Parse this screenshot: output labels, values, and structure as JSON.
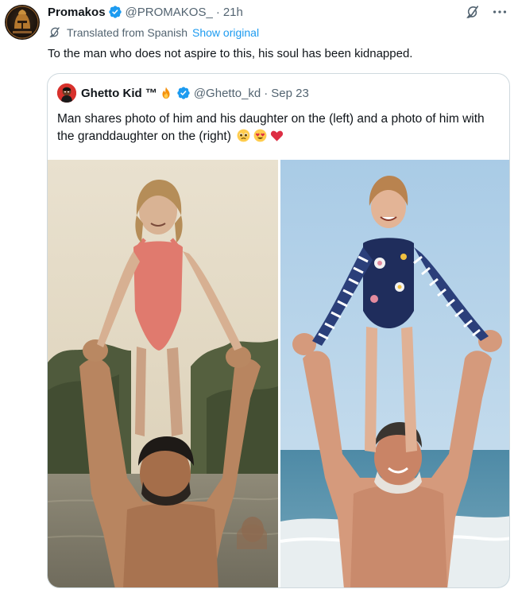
{
  "post": {
    "author": {
      "name": "Promakos",
      "handle": "@PROMAKOS_",
      "time": "21h"
    },
    "translation": {
      "label": "Translated from Spanish",
      "link": "Show original"
    },
    "text": "To the man who does not aspire to this, his soul has been kidnapped."
  },
  "quote": {
    "author": {
      "name": "Ghetto Kid ™",
      "handle": "@Ghetto_kd",
      "time": "Sep 23"
    },
    "text": "Man shares photo of him and his daughter on the (left) and a photo of him with the granddaughter on the (right)",
    "emojis": [
      "pleading-face",
      "heart-eyes-face",
      "red-heart"
    ]
  },
  "icons": {
    "verified": "verified-badge-icon",
    "grok": "grok-icon",
    "more": "more-icon",
    "translate": "translate-icon"
  },
  "colors": {
    "link": "#1d9bf0",
    "verified": "#1d9bf0",
    "secondary_text": "#536471",
    "border": "#cfd9de"
  }
}
